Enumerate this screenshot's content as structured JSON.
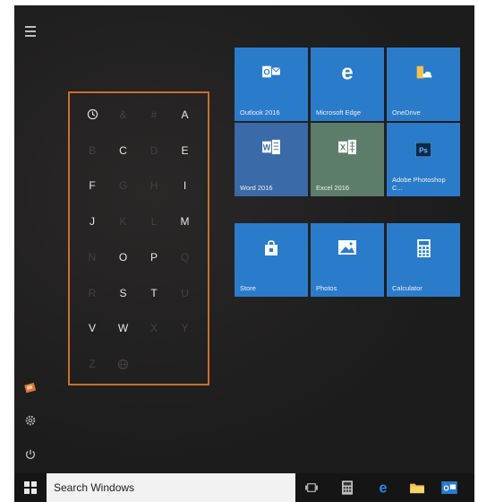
{
  "colors": {
    "menu_bg": "#1f1f1f",
    "tile_blue": "#2b7bcb",
    "word_tile": "#3a6aa8",
    "excel_tile": "#5c7d6a",
    "grid_border": "#c8702a"
  },
  "left_rail": {
    "icons": [
      "hamburger-icon",
      "photo-icon",
      "settings-icon",
      "power-icon"
    ]
  },
  "letter_grid": {
    "rows": [
      [
        {
          "t": "clock",
          "active": true,
          "icon": true
        },
        {
          "t": "&",
          "active": false
        },
        {
          "t": "#",
          "active": false
        },
        {
          "t": "A",
          "active": true
        }
      ],
      [
        {
          "t": "B",
          "active": false
        },
        {
          "t": "C",
          "active": true
        },
        {
          "t": "D",
          "active": false
        },
        {
          "t": "E",
          "active": true
        }
      ],
      [
        {
          "t": "F",
          "active": true
        },
        {
          "t": "G",
          "active": false
        },
        {
          "t": "H",
          "active": false
        },
        {
          "t": "I",
          "active": true
        }
      ],
      [
        {
          "t": "J",
          "active": true
        },
        {
          "t": "K",
          "active": false
        },
        {
          "t": "L",
          "active": false
        },
        {
          "t": "M",
          "active": true
        }
      ],
      [
        {
          "t": "N",
          "active": false
        },
        {
          "t": "O",
          "active": true
        },
        {
          "t": "P",
          "active": true
        },
        {
          "t": "Q",
          "active": false
        }
      ],
      [
        {
          "t": "R",
          "active": false
        },
        {
          "t": "S",
          "active": true
        },
        {
          "t": "T",
          "active": true
        },
        {
          "t": "U",
          "active": false
        }
      ],
      [
        {
          "t": "V",
          "active": true
        },
        {
          "t": "W",
          "active": true
        },
        {
          "t": "X",
          "active": false
        },
        {
          "t": "Y",
          "active": false
        }
      ],
      [
        {
          "t": "Z",
          "active": false
        },
        {
          "t": "globe",
          "active": false,
          "icon": true
        },
        {
          "t": "",
          "active": false
        },
        {
          "t": "",
          "active": false
        }
      ]
    ]
  },
  "tiles": {
    "outlook": "Outlook 2016",
    "edge": "Microsoft Edge",
    "onedrive": "OneDrive",
    "word": "Word 2016",
    "excel": "Excel 2016",
    "photoshop": "Adobe Photoshop C...",
    "store": "Store",
    "photos": "Photos",
    "calculator": "Calculator"
  },
  "taskbar": {
    "search_placeholder": "Search Windows",
    "icons": [
      "task-view-icon",
      "calculator-icon",
      "edge-icon",
      "file-explorer-icon",
      "outlook-icon"
    ]
  }
}
